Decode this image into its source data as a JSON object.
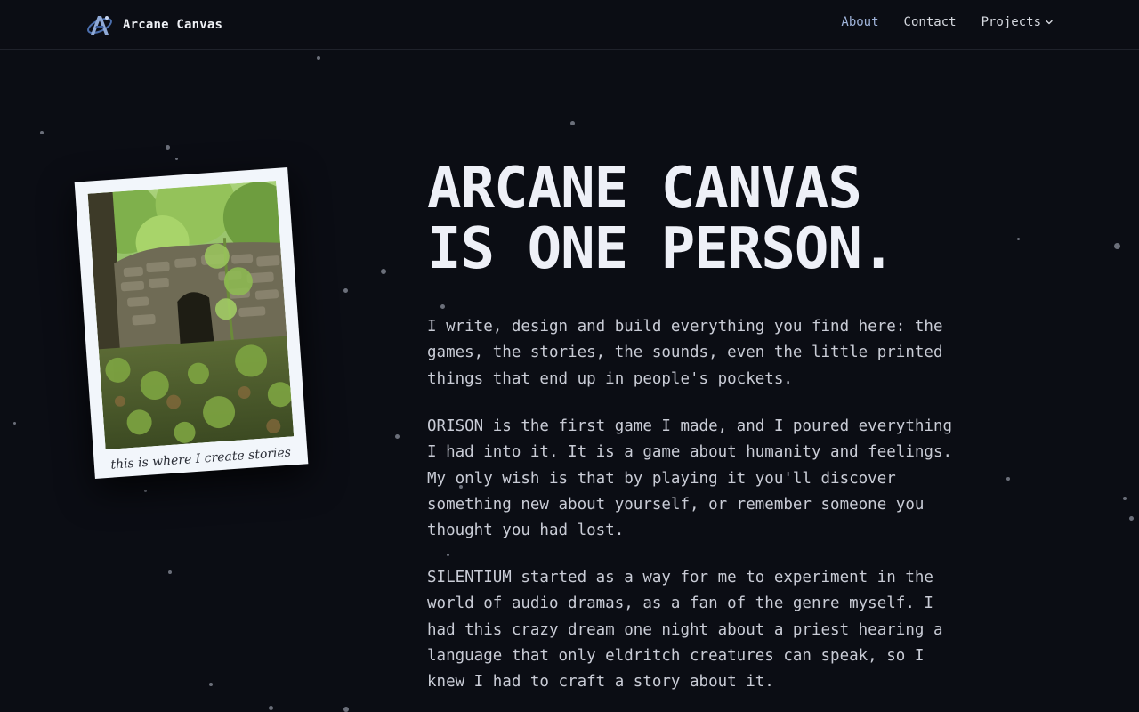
{
  "header": {
    "brand_logo": "arcane-canvas-logo",
    "brand_name": "Arcane Canvas",
    "nav": [
      {
        "label": "About",
        "active": true
      },
      {
        "label": "Contact",
        "active": false
      },
      {
        "label": "Projects",
        "active": false,
        "icon": "chevron-down-icon"
      }
    ]
  },
  "polaroid": {
    "photo": "stone-ruin-in-forest",
    "caption": "this is where I create stories"
  },
  "hero": {
    "title_line1": "ARCANE CANVAS",
    "title_line2": "IS ONE PERSON.",
    "paragraphs": [
      "I write, design and build everything you find here: the games, the stories, the sounds, even the little printed things that end up in people's pockets.",
      "ORISON is the first game I made, and I poured everything I had into it. It is a game about humanity and feelings. My only wish is that by playing it you'll discover something new about yourself, or remember someone you thought you had lost.",
      "SILENTIUM started as a way for me to experiment in the world of audio dramas, as a fan of the genre myself. I had this crazy dream one night about a priest hearing a language that only eldritch creatures can speak, so I knew I had to craft a story about it."
    ]
  },
  "colors": {
    "background": "#0b0d14",
    "text": "#c9ccd6",
    "title": "#eef0f7",
    "accent": "#9fb3d9"
  }
}
